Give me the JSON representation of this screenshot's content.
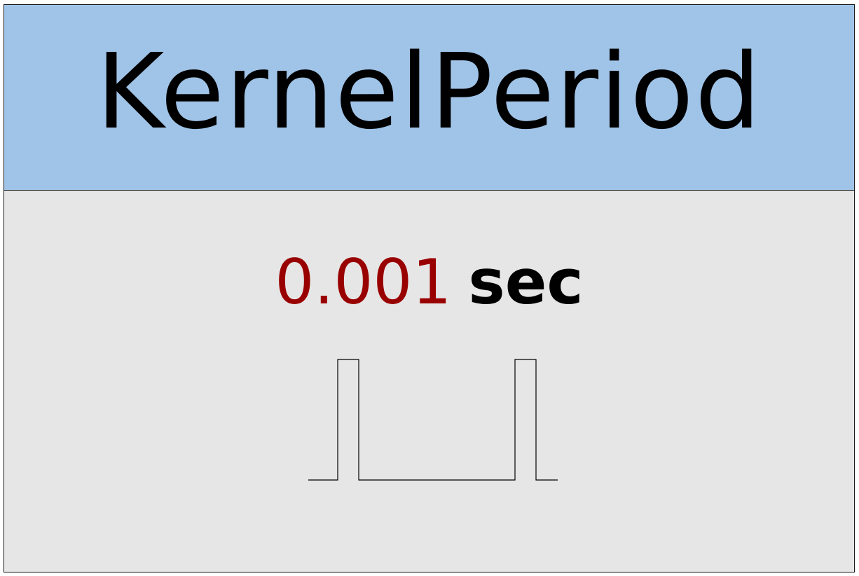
{
  "header": {
    "title": "KernelPeriod"
  },
  "period": {
    "value": "0.001",
    "unit": "sec"
  },
  "colors": {
    "header_bg": "#a0c4e8",
    "value": "#990000",
    "panel_bg": "#e6e6e6"
  }
}
